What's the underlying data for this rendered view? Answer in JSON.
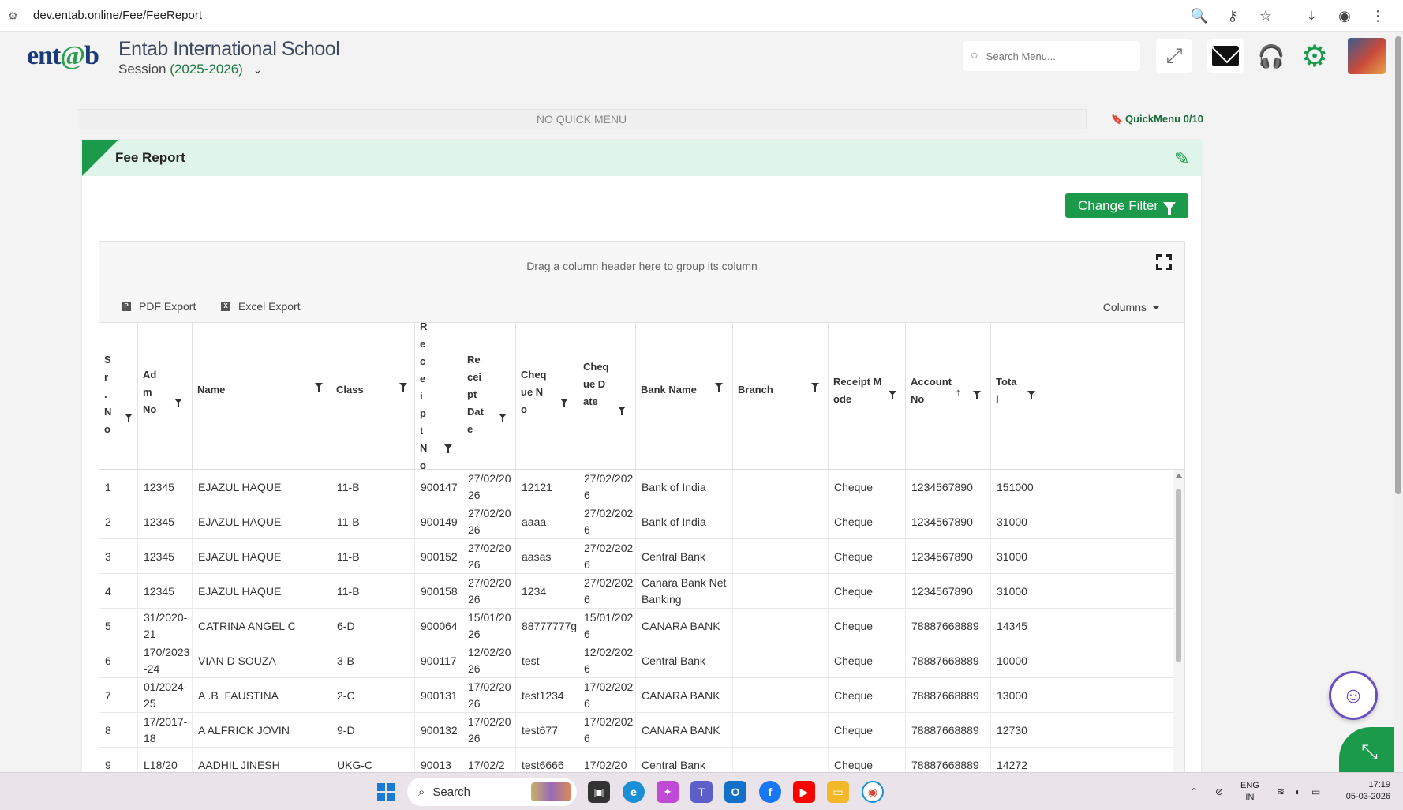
{
  "browser": {
    "url": "dev.entab.online/Fee/FeeReport"
  },
  "header": {
    "logo_text": "entab",
    "school_name": "Entab International School",
    "session_label": "Session",
    "session_year": "(2025-2026)",
    "search_placeholder": "Search Menu..."
  },
  "quick_menu": {
    "empty_text": "NO QUICK MENU",
    "label": "QuickMenu",
    "count": "0/10"
  },
  "panel": {
    "title": "Fee Report",
    "change_filter_label": "Change Filter"
  },
  "grid": {
    "group_hint": "Drag a column header here to group its column",
    "pdf_export": "PDF Export",
    "excel_export": "Excel Export",
    "columns_label": "Columns",
    "headers": [
      "Sr.No",
      "Adm No",
      "Name",
      "Class",
      "Receipt No",
      "Receipt Date",
      "Cheque No",
      "Cheque Date",
      "Bank Name",
      "Branch",
      "Receipt Mode",
      "Account No",
      "Total"
    ],
    "rows": [
      [
        "1",
        "12345",
        "EJAZUL HAQUE",
        "11-B",
        "900147",
        "27/02/2026",
        "12121",
        "27/02/2026",
        "Bank of India",
        "",
        "Cheque",
        "1234567890",
        "151000"
      ],
      [
        "2",
        "12345",
        "EJAZUL HAQUE",
        "11-B",
        "900149",
        "27/02/2026",
        "aaaa",
        "27/02/2026",
        "Bank of India",
        "",
        "Cheque",
        "1234567890",
        "31000"
      ],
      [
        "3",
        "12345",
        "EJAZUL HAQUE",
        "11-B",
        "900152",
        "27/02/2026",
        "aasas",
        "27/02/2026",
        "Central Bank",
        "",
        "Cheque",
        "1234567890",
        "31000"
      ],
      [
        "4",
        "12345",
        "EJAZUL HAQUE",
        "11-B",
        "900158",
        "27/02/2026",
        "1234",
        "27/02/2026",
        "Canara Bank NetBanking",
        "",
        "Cheque",
        "1234567890",
        "31000"
      ],
      [
        "5",
        "31/2020-21",
        "CATRINA ANGEL C",
        "6-D",
        "900064",
        "15/01/2026",
        "88777777g",
        "15/01/2026",
        "CANARA BANK",
        "",
        "Cheque",
        "78887668889",
        "14345"
      ],
      [
        "6",
        "170/2023-24",
        "VIAN D SOUZA",
        "3-B",
        "900117",
        "12/02/2026",
        "test",
        "12/02/2026",
        "Central Bank",
        "",
        "Cheque",
        "78887668889",
        "10000"
      ],
      [
        "7",
        "01/2024-25",
        "A .B .FAUSTINA",
        "2-C",
        "900131",
        "17/02/2026",
        "test1234",
        "17/02/2026",
        "CANARA BANK",
        "",
        "Cheque",
        "78887668889",
        "13000"
      ],
      [
        "8",
        "17/2017-18",
        "A ALFRICK JOVIN",
        "9-D",
        "900132",
        "17/02/2026",
        "test677",
        "17/02/2026",
        "CANARA BANK",
        "",
        "Cheque",
        "78887668889",
        "12730"
      ],
      [
        "9",
        "L18/20",
        "AADHIL JINESH",
        "UKG-C",
        "90013",
        "17/02/2",
        "test6666",
        "17/02/20",
        "Central Bank",
        "",
        "Cheque",
        "78887668889",
        "14272"
      ]
    ]
  },
  "taskbar": {
    "search_label": "Search",
    "lang_top": "ENG",
    "lang_bottom": "IN",
    "time": "17:19",
    "date": "05-03-2026"
  }
}
